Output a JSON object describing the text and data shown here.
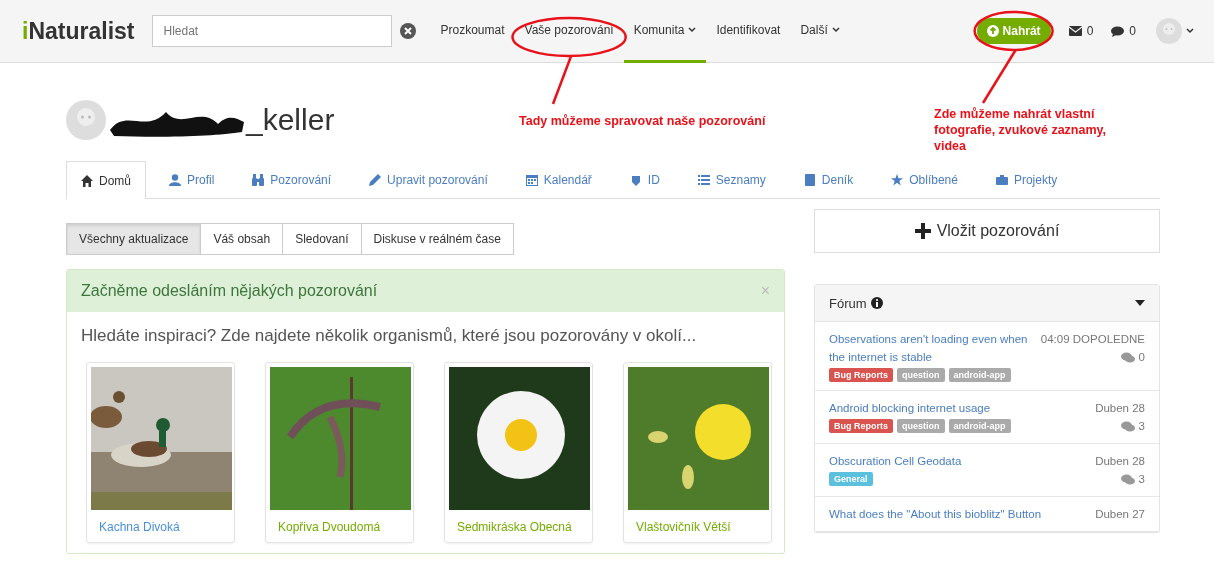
{
  "header": {
    "logo": "iNaturalist",
    "search": {
      "placeholder": "Hledat"
    },
    "nav": [
      {
        "label": "Prozkoumat",
        "selected": false,
        "dropdown": false
      },
      {
        "label": "Vaše pozorování",
        "selected": false,
        "dropdown": false
      },
      {
        "label": "Komunita",
        "selected": true,
        "dropdown": true
      },
      {
        "label": "Identifikovat",
        "selected": false,
        "dropdown": false
      },
      {
        "label": "Další",
        "selected": false,
        "dropdown": true
      }
    ],
    "upload": "Nahrát",
    "messages": "0",
    "notifications": "0"
  },
  "profile": {
    "username": "_keller",
    "tabs": [
      {
        "label": "Domů",
        "selected": true
      },
      {
        "label": "Profil",
        "selected": false
      },
      {
        "label": "Pozorování",
        "selected": false
      },
      {
        "label": "Upravit pozorování",
        "selected": false
      },
      {
        "label": "Kalendář",
        "selected": false
      },
      {
        "label": "ID",
        "selected": false
      },
      {
        "label": "Seznamy",
        "selected": false
      },
      {
        "label": "Deník",
        "selected": false
      },
      {
        "label": "Oblíbené",
        "selected": false
      },
      {
        "label": "Projekty",
        "selected": false
      }
    ]
  },
  "feed_tabs": [
    {
      "label": "Všechny aktualizace",
      "selected": true
    },
    {
      "label": "Váš obsah",
      "selected": false
    },
    {
      "label": "Sledovaní",
      "selected": false
    },
    {
      "label": "Diskuse v reálném čase",
      "selected": false
    }
  ],
  "welcome": {
    "title": "Začněme odesláním nějakých pozorování",
    "close": "×",
    "intro": "Hledáte inspiraci? Zde najdete několik organismů, které jsou pozorovány v okolí...",
    "organisms": [
      {
        "name": "Kachna Divoká",
        "color": "#4a90d9"
      },
      {
        "name": "Kopřiva Dvoudomá",
        "color": "#74ac00"
      },
      {
        "name": "Sedmikráska Obecná",
        "color": "#74ac00"
      },
      {
        "name": "Vlaštovičník Větší",
        "color": "#74ac00"
      }
    ]
  },
  "add_button": "Vložit pozorování",
  "forum": {
    "title": "Fórum",
    "posts": [
      {
        "title": "Observations aren't loading even when the internet is stable",
        "date": "04:09 DOPOLEDNE",
        "comments": "0",
        "tags": [
          {
            "label": "Bug Reports",
            "color": "#d9534f"
          },
          {
            "label": "question",
            "color": "#aaaaaa"
          },
          {
            "label": "android-app",
            "color": "#aaaaaa"
          }
        ]
      },
      {
        "title": "Android blocking internet usage",
        "date": "Duben 28",
        "comments": "3",
        "tags": [
          {
            "label": "Bug Reports",
            "color": "#d9534f"
          },
          {
            "label": "question",
            "color": "#aaaaaa"
          },
          {
            "label": "android-app",
            "color": "#aaaaaa"
          }
        ]
      },
      {
        "title": "Obscuration Cell Geodata",
        "date": "Duben 28",
        "comments": "3",
        "tags": [
          {
            "label": "General",
            "color": "#5bc0de"
          }
        ]
      },
      {
        "title": "What does the \"About this bioblitz\" Button",
        "date": "Duben 27"
      }
    ]
  },
  "annotations": [
    {
      "text": "Tady můžeme spravovat naše pozorování"
    },
    {
      "text": "Zde můžeme nahrát vlastní fotografie, zvukové zaznamy, videa"
    }
  ]
}
